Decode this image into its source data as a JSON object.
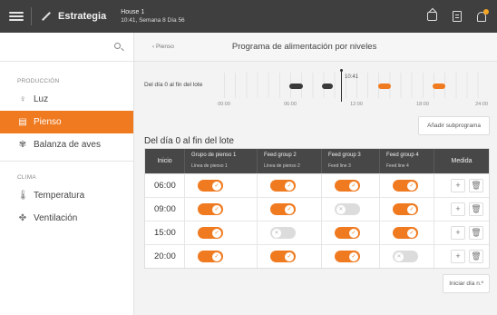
{
  "topbar": {
    "title": "Estrategia",
    "house": "House 1",
    "date_line": "10:41, Semana 8 Día 56"
  },
  "sidebar": {
    "sections": [
      {
        "label": "PRODUCCIÓN",
        "items": [
          {
            "label": "Luz",
            "icon": "bulb-icon"
          },
          {
            "label": "Pienso",
            "icon": "feed-icon",
            "active": true
          },
          {
            "label": "Balanza de aves",
            "icon": "bird-scale-icon"
          }
        ]
      },
      {
        "label": "CLIMA",
        "items": [
          {
            "label": "Temperatura",
            "icon": "thermometer-icon"
          },
          {
            "label": "Ventilación",
            "icon": "fan-icon"
          }
        ]
      }
    ]
  },
  "breadcrumb": {
    "back": "‹  Pienso"
  },
  "page_title": "Programa de alimentación por niveles",
  "timeline": {
    "label": "Del día 0 al fin del lote",
    "now": "10:41",
    "ticks": [
      "00:00",
      "06:00",
      "12:00",
      "18:00",
      "24:00"
    ],
    "colors": {
      "past": "#3a3a3a",
      "future": "#f07a1f"
    }
  },
  "buttons": {
    "add_subprogram": "Añadir subprograma",
    "start_day": "Iniciar día n.º"
  },
  "section_title": "Del día 0 al fin del lote",
  "table": {
    "columns": [
      {
        "main": "Inicio",
        "sub": ""
      },
      {
        "main": "Grupo de pienso 1",
        "sub": "Línea de pienso 1"
      },
      {
        "main": "Feed group 2",
        "sub": "Línea de pienso 2"
      },
      {
        "main": "Feed group 3",
        "sub": "Feed line 3"
      },
      {
        "main": "Feed group 4",
        "sub": "Feed line 4"
      },
      {
        "main": "Medida",
        "sub": ""
      }
    ],
    "rows": [
      {
        "time": "06:00",
        "toggles": [
          true,
          true,
          true,
          true
        ]
      },
      {
        "time": "09:00",
        "toggles": [
          true,
          true,
          false,
          true
        ]
      },
      {
        "time": "15:00",
        "toggles": [
          true,
          false,
          true,
          true
        ]
      },
      {
        "time": "20:00",
        "toggles": [
          true,
          true,
          true,
          false
        ]
      }
    ],
    "actions": {
      "add": "+",
      "delete": "🗑"
    }
  }
}
